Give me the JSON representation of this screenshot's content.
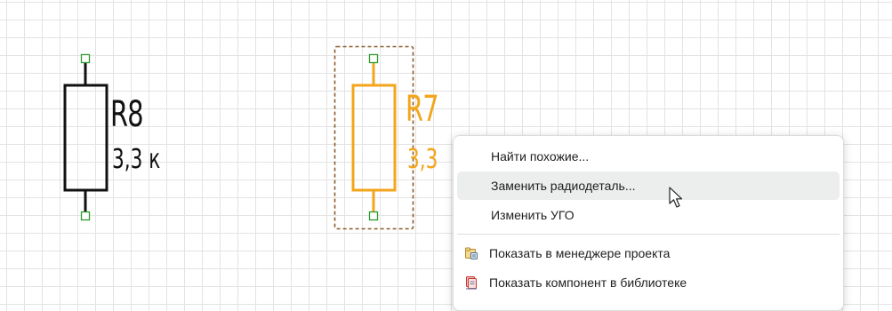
{
  "components": [
    {
      "name": "R8",
      "value": "3,3 к",
      "selected": false
    },
    {
      "name": "R7",
      "value": "3,3",
      "selected": true
    }
  ],
  "colors": {
    "normal_stroke": "#111111",
    "selected_stroke": "#f3a51b",
    "pin": "#2e9b2e",
    "selection_box": "#8a5a2b",
    "hover": "#eceeed"
  },
  "context_menu": {
    "items": [
      {
        "label": "Найти похожие...",
        "icon": null,
        "hover": false
      },
      {
        "label": "Заменить радиодеталь...",
        "icon": null,
        "hover": true
      },
      {
        "label": "Изменить УГО",
        "icon": null,
        "hover": false
      },
      {
        "label": "Показать в менеджере проекта",
        "icon": "project-manager-icon",
        "hover": false
      },
      {
        "label": "Показать компонент в библиотеке",
        "icon": "library-icon",
        "hover": false
      }
    ]
  }
}
